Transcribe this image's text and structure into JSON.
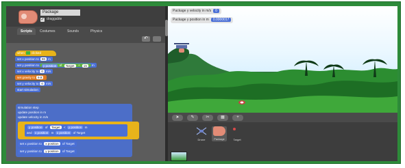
{
  "sprite": {
    "name": "Package",
    "draggable_label": "draggable",
    "draggable_checked": true
  },
  "tabs": [
    {
      "label": "Scripts",
      "active": true
    },
    {
      "label": "Costumes",
      "active": false
    },
    {
      "label": "Sounds",
      "active": false
    },
    {
      "label": "Physics",
      "active": false
    }
  ],
  "toolbar": {
    "undo_icon": "undo-icon",
    "redo_icon": "redo-icon",
    "undo_glyph": "↶"
  },
  "script1": {
    "hat": "when",
    "hat_suffix": "clicked",
    "l1_text": "set x position to",
    "l1_val": "90",
    "l1_unit": "m",
    "l2_text": "set y position to",
    "l2_rep1": "y position",
    "l2_of": "of",
    "l2_rep2": "Target",
    "l2_plus": "+",
    "l2_val": "15",
    "l2_unit": "m",
    "l3_text": "set x velocity to",
    "l3_val": "0",
    "l3_unit": "m/s",
    "l4_text": "set gravity to",
    "l4_val": "9.8",
    "l5_text": "set y velocity to",
    "l5_val": "0",
    "l5_unit": "m/s",
    "l6_text": "start simulation"
  },
  "script2": {
    "hat": "simulation step",
    "l1": "update position in m",
    "l2": "update velocity in m/s",
    "if_a": "y position",
    "if_of": "of",
    "if_target": "Target",
    "if_lt": "<",
    "if_b": "y position",
    "if_m": "m",
    "and": "and",
    "if_c": "x position",
    "if_d": "x position",
    "set_x": "set x position to",
    "set_x_val": "x position",
    "set_y": "set y position to",
    "set_y_val": "y position",
    "of_target": "of Target"
  },
  "watchers": [
    {
      "label": "Package y velocity in m/s",
      "value": "0"
    },
    {
      "label": "Package y position in m",
      "value": "0.0000017"
    }
  ],
  "stage_tools": [
    {
      "name": "arrow-tool-icon",
      "glyph": "➤"
    },
    {
      "name": "paint-brush-icon",
      "glyph": "✎"
    },
    {
      "name": "turtle-import-icon",
      "glyph": "✂"
    },
    {
      "name": "grid-icon",
      "glyph": "▦"
    },
    {
      "name": "add-sprite-icon",
      "glyph": "+"
    }
  ],
  "sprites": [
    {
      "label": "Drone"
    },
    {
      "label": "Package"
    },
    {
      "label": "Target"
    }
  ],
  "colors": {
    "frame": "#2e8b3a",
    "motion_blue": "#4a6fd6",
    "control_yellow": "#e8b31a",
    "package_salmon": "#e28b76"
  }
}
